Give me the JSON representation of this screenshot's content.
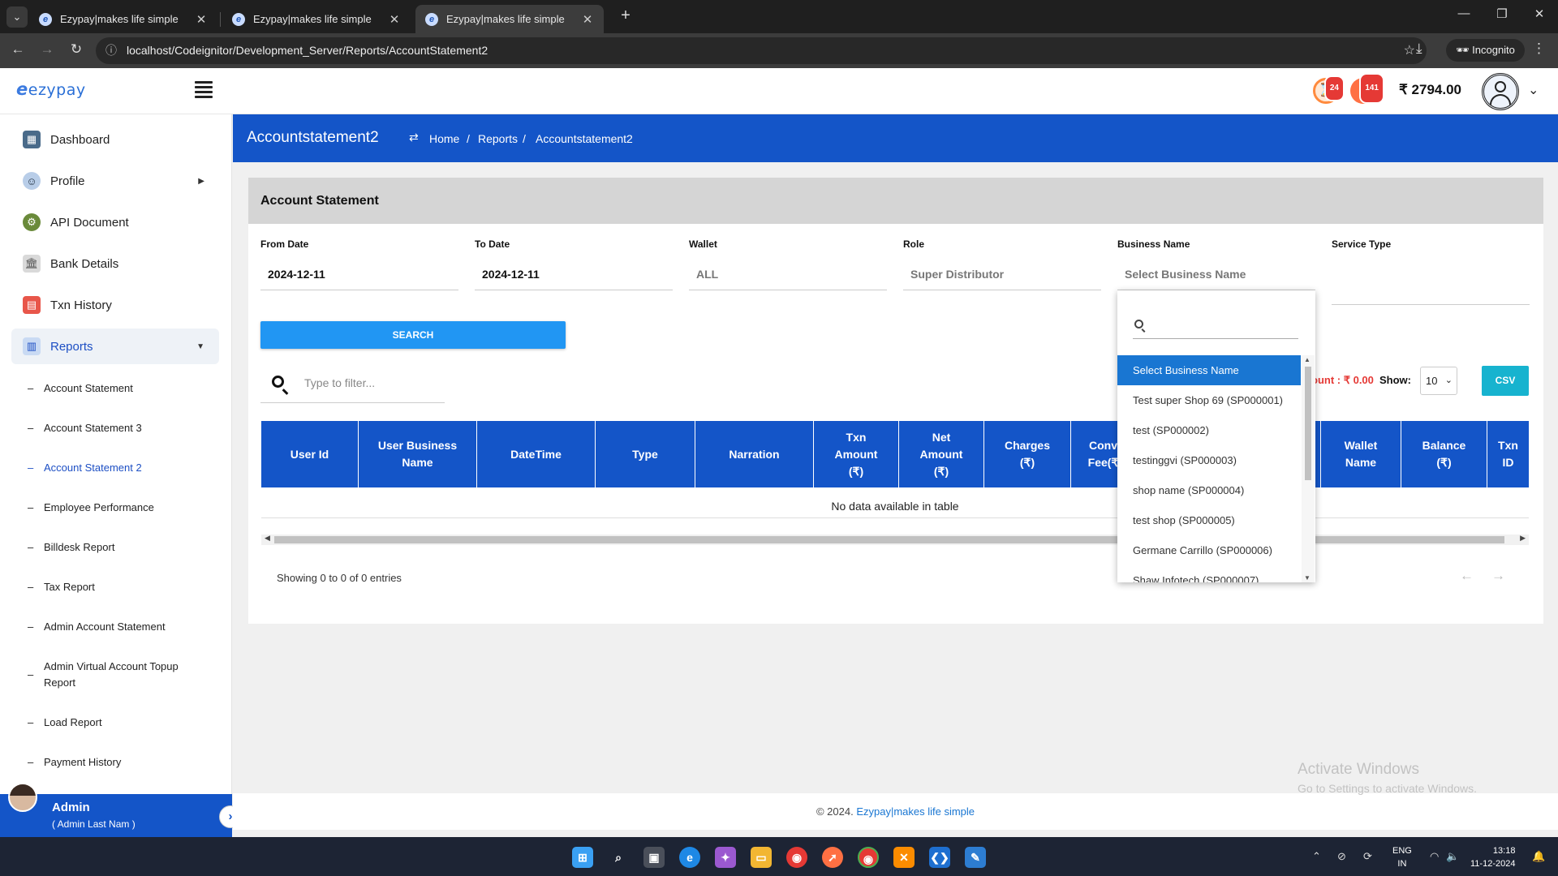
{
  "browser": {
    "tabs": [
      {
        "title": "Ezypay|makes life simple",
        "active": false
      },
      {
        "title": "Ezypay|makes life simple",
        "active": false
      },
      {
        "title": "Ezypay|makes life simple",
        "active": true
      }
    ],
    "url": "localhost/Codeignitor/Development_Server/Reports/AccountStatement2",
    "incognito_label": "Incognito"
  },
  "header": {
    "logo_text": "ezypay",
    "logo_letter": "e",
    "notif_pending_count": "24",
    "notif_wallet_count": "141",
    "balance": "₹ 2794.00"
  },
  "sidebar": {
    "menu": [
      {
        "label": "Dashboard",
        "icon": "dashboard-icon"
      },
      {
        "label": "Profile",
        "icon": "profile-icon"
      },
      {
        "label": "API Document",
        "icon": "api-document-icon"
      },
      {
        "label": "Bank Details",
        "icon": "bank-icon"
      },
      {
        "label": "Txn History",
        "icon": "txn-history-icon"
      },
      {
        "label": "Reports",
        "icon": "reports-icon"
      }
    ],
    "sub_items": [
      "Account Statement",
      "Account Statement 3",
      "Account Statement 2",
      "Employee Performance",
      "Billdesk Report",
      "Tax Report",
      "Admin Account Statement",
      "Admin Virtual Account Topup Report",
      "Load Report",
      "Payment History"
    ],
    "user": {
      "name": "Admin",
      "role": "( Admin Last Nam )"
    }
  },
  "banner": {
    "title": "Accountstatement2",
    "breadcrumb": [
      "Home",
      "Reports",
      "Accountstatement2"
    ],
    "separator": "/"
  },
  "card": {
    "title": "Account Statement",
    "filters": {
      "from_date": {
        "label": "From Date",
        "value": "2024-12-11"
      },
      "to_date": {
        "label": "To Date",
        "value": "2024-12-11"
      },
      "wallet": {
        "label": "Wallet",
        "value": "ALL"
      },
      "role": {
        "label": "Role",
        "value": "Super Distributor"
      },
      "business_name": {
        "label": "Business Name",
        "value": "Select Business Name"
      },
      "service_type": {
        "label": "Service Type",
        "value": ""
      }
    },
    "search_button": "SEARCH",
    "filter_placeholder": "Type to filter...",
    "amount_text": "ount : ₹ 0.00",
    "show_label": "Show:",
    "page_size": "10",
    "csv_button": "CSV",
    "table": {
      "columns": [
        "User Id",
        "User Business Name",
        "DateTime",
        "Type",
        "Narration",
        "Txn Amount (₹)",
        "Net Amount (₹)",
        "Charges (₹)",
        "Conv Fee(₹",
        "",
        "Wallet Name",
        "Balance (₹)",
        "Txn ID"
      ],
      "empty_message": "No data available in table"
    },
    "showing_text": "Showing 0 to 0 of 0 entries",
    "prev_arrow": "←",
    "next_arrow": "→"
  },
  "business_dropdown": {
    "options": [
      "Select Business Name",
      "Test super Shop 69 (SP000001)",
      "test (SP000002)",
      "testinggvi (SP000003)",
      "shop name (SP000004)",
      "test shop (SP000005)",
      "Germane Carrillo (SP000006)",
      "Shaw Infotech (SP000007)"
    ],
    "selected_index": 0
  },
  "footer": {
    "copyright": "© 2024.",
    "link": "Ezypay|makes life simple"
  },
  "watermark": {
    "line1": "Activate Windows",
    "line2": "Go to Settings to activate Windows."
  },
  "taskbar": {
    "lang_line1": "ENG",
    "lang_line2": "IN",
    "time": "13:18",
    "date": "11-12-2024"
  },
  "colors": {
    "primary_blue": "#1455c8",
    "search_button": "#2196f3",
    "csv_button": "#17b3cf",
    "amount_red": "#e53935",
    "dropdown_selected": "#1976d2"
  }
}
